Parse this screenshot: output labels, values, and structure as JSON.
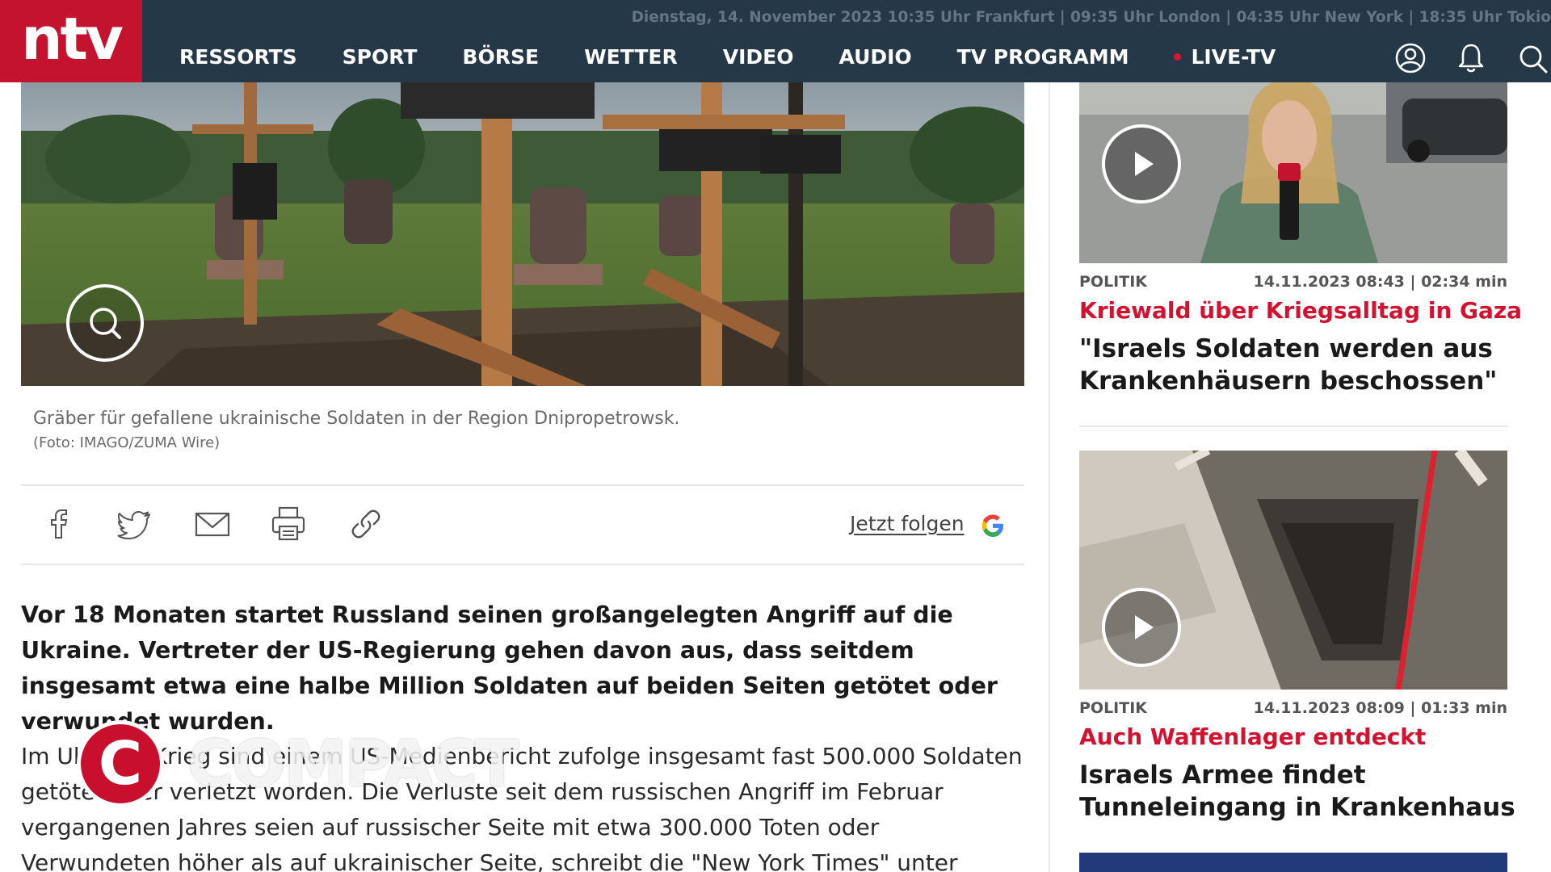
{
  "header": {
    "logo": "ntv",
    "dateline": "Dienstag, 14. November 2023 10:35 Uhr Frankfurt | 09:35 Uhr London | 04:35 Uhr New York | 18:35 Uhr Tokio",
    "nav": [
      "RESSORTS",
      "SPORT",
      "BÖRSE",
      "WETTER",
      "VIDEO",
      "AUDIO",
      "TV PROGRAMM",
      "LIVE-TV"
    ],
    "icons": [
      "user-icon",
      "bell-icon",
      "search-icon"
    ]
  },
  "article": {
    "caption": "Gräber für gefallene ukrainische Soldaten in der Region Dnipropetrowsk.",
    "credit": "(Foto: IMAGO/ZUMA Wire)",
    "follow_label": "Jetzt folgen",
    "lead": "Vor 18 Monaten startet Russland seinen großangelegten Angriff auf die Ukraine. Vertreter der US-Regierung gehen davon aus, dass seitdem insgesamt etwa eine halbe Million Soldaten auf beiden Seiten getötet oder verwundet wurden.",
    "body": "Im Ukraine-Krieg sind einem US-Medienbericht zufolge insgesamt fast 500.000 Soldaten getötet oder verletzt worden. Die Verluste seit dem russischen Angriff im Februar vergangenen Jahres seien auf russischer Seite mit etwa 300.000 Toten oder Verwundeten höher als auf ukrainischer Seite, schreibt die \"New York Times\" unter"
  },
  "watermark": {
    "letter": "C",
    "text": "COMPACT"
  },
  "sidebar": {
    "items": [
      {
        "category": "POLITIK",
        "meta": "14.11.2023 08:43 | 02:34 min",
        "kicker": "Kriewald über Kriegsalltag in Gaza",
        "title": "\"Israels Soldaten werden aus Krankenhäusern beschossen\""
      },
      {
        "category": "POLITIK",
        "meta": "14.11.2023 08:09 | 01:33 min",
        "kicker": "Auch Waffenlager entdeckt",
        "title": "Israels Armee findet Tunneleingang in Krankenhaus"
      }
    ]
  },
  "colors": {
    "brand_red": "#c4132f",
    "header_bg": "#243847",
    "kicker_red": "#d4122f"
  }
}
